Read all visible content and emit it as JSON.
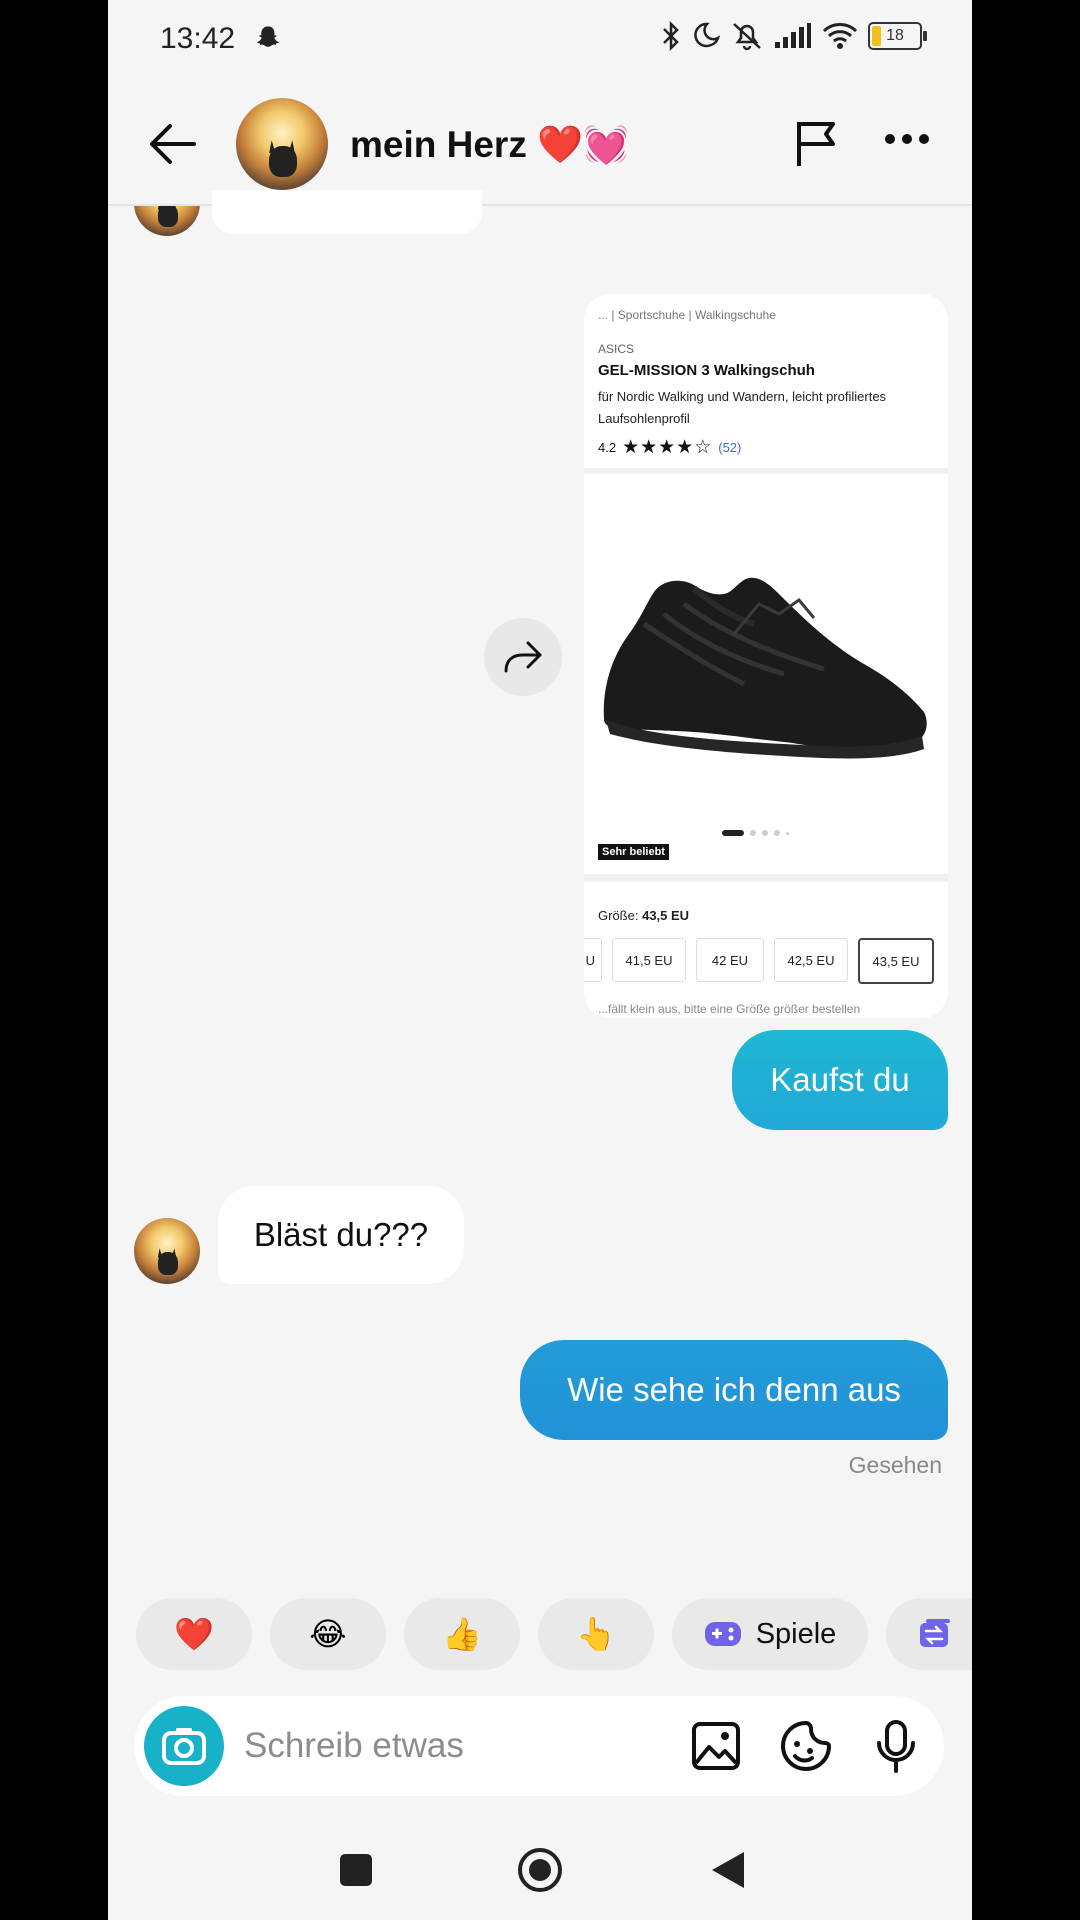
{
  "status_bar": {
    "time": "13:42",
    "battery": "18",
    "icons": [
      "snapchat-icon",
      "bluetooth-icon",
      "moon-icon",
      "mute-icon",
      "signal-icon",
      "wifi-icon",
      "battery-icon"
    ]
  },
  "header": {
    "title": "mein Herz ❤️💓",
    "icons": [
      "back-arrow-icon",
      "flag-icon",
      "more-icon"
    ]
  },
  "product_card": {
    "breadcrumb": "... | Sportschuhe | Walkingschuhe",
    "brand": "ASICS",
    "name": "GEL-MISSION 3 Walkingschuh",
    "description": "für Nordic Walking und Wandern, leicht profiliertes Laufsohlenprofil",
    "rating": "4.2",
    "stars": "★★★★☆",
    "rating_value": 4,
    "review_count": "(52)",
    "badge": "Sehr beliebt",
    "size_label": "Größe:",
    "size_selected": "43,5 EU",
    "sizes": [
      "U",
      "41,5 EU",
      "42 EU",
      "42,5 EU",
      "43,5 EU"
    ],
    "note": "...fällt klein aus, bitte eine Größe größer bestellen"
  },
  "messages": [
    {
      "type": "out",
      "text": "Kaufst du"
    },
    {
      "type": "in",
      "text": "Bläst du???"
    },
    {
      "type": "out",
      "text": "Wie sehe ich denn aus"
    }
  ],
  "seen": "Gesehen",
  "quick_reactions": [
    "❤️",
    "😂",
    "👍",
    "👆"
  ],
  "games_label": "Spiele",
  "input": {
    "placeholder": "Schreib etwas"
  },
  "colors": {
    "outgoing_top": "#21b2d6",
    "outgoing_bottom": "#238ad6",
    "camera": "#17b1c8",
    "games": "#6f63e8"
  }
}
